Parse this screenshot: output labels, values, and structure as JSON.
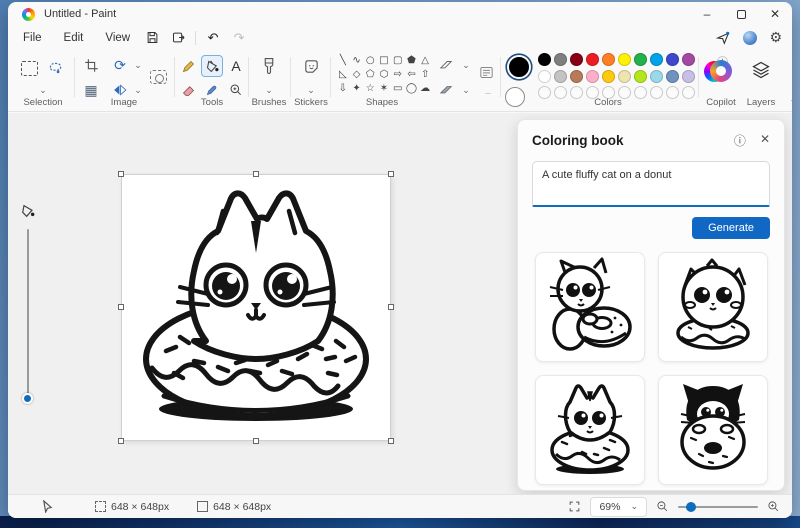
{
  "window": {
    "title": "Untitled - Paint"
  },
  "menu": {
    "items": [
      "File",
      "Edit",
      "View"
    ]
  },
  "icons": {
    "minimize": "–",
    "close": "✕",
    "undo": "↶",
    "redo": "↷",
    "settings": "⚙",
    "dropdown": "⌄",
    "info": "ⓘ",
    "panel_close": "✕",
    "resize": "▦",
    "rotate": "⟳",
    "text_tool": "A"
  },
  "ribbon": {
    "labels": {
      "selection": "Selection",
      "image": "Image",
      "tools": "Tools",
      "brushes": "Brushes",
      "stickers": "Stickers",
      "shapes": "Shapes",
      "colors": "Colors",
      "copilot": "Copilot",
      "layers": "Layers"
    }
  },
  "shapes": {
    "glyphs": [
      "╲",
      "∿",
      "○",
      "□",
      "▢",
      "⬟",
      "△",
      "◺",
      "◇",
      "⬠",
      "⬡",
      "⇨",
      "⇦",
      "⇧",
      "⇩",
      "✦",
      "☆",
      "✶",
      "▭",
      "◯",
      "☁"
    ]
  },
  "colors": {
    "color1": "#000000",
    "color2": "#ffffff",
    "accent": "#0F6CBD",
    "palette": [
      [
        "#000000",
        "#7F7F7F",
        "#880015",
        "#ED1C24",
        "#FF7F27",
        "#FFF200",
        "#22B14C",
        "#00A2E8",
        "#3F48CC",
        "#A349A4"
      ],
      [
        "#FFFFFF",
        "#C3C3C3",
        "#B97A57",
        "#FFAEC9",
        "#FFC90E",
        "#EFE4B0",
        "#B5E61D",
        "#99D9EA",
        "#7092BE",
        "#C8BFE7"
      ],
      [
        null,
        null,
        null,
        null,
        null,
        null,
        null,
        null,
        null,
        null
      ]
    ]
  },
  "panel": {
    "title": "Coloring book",
    "prompt": "A cute fluffy cat on a donut",
    "generate_label": "Generate"
  },
  "status": {
    "selection_size": "648 × 648px",
    "canvas_size": "648 × 648px",
    "zoom_level": "69%"
  }
}
